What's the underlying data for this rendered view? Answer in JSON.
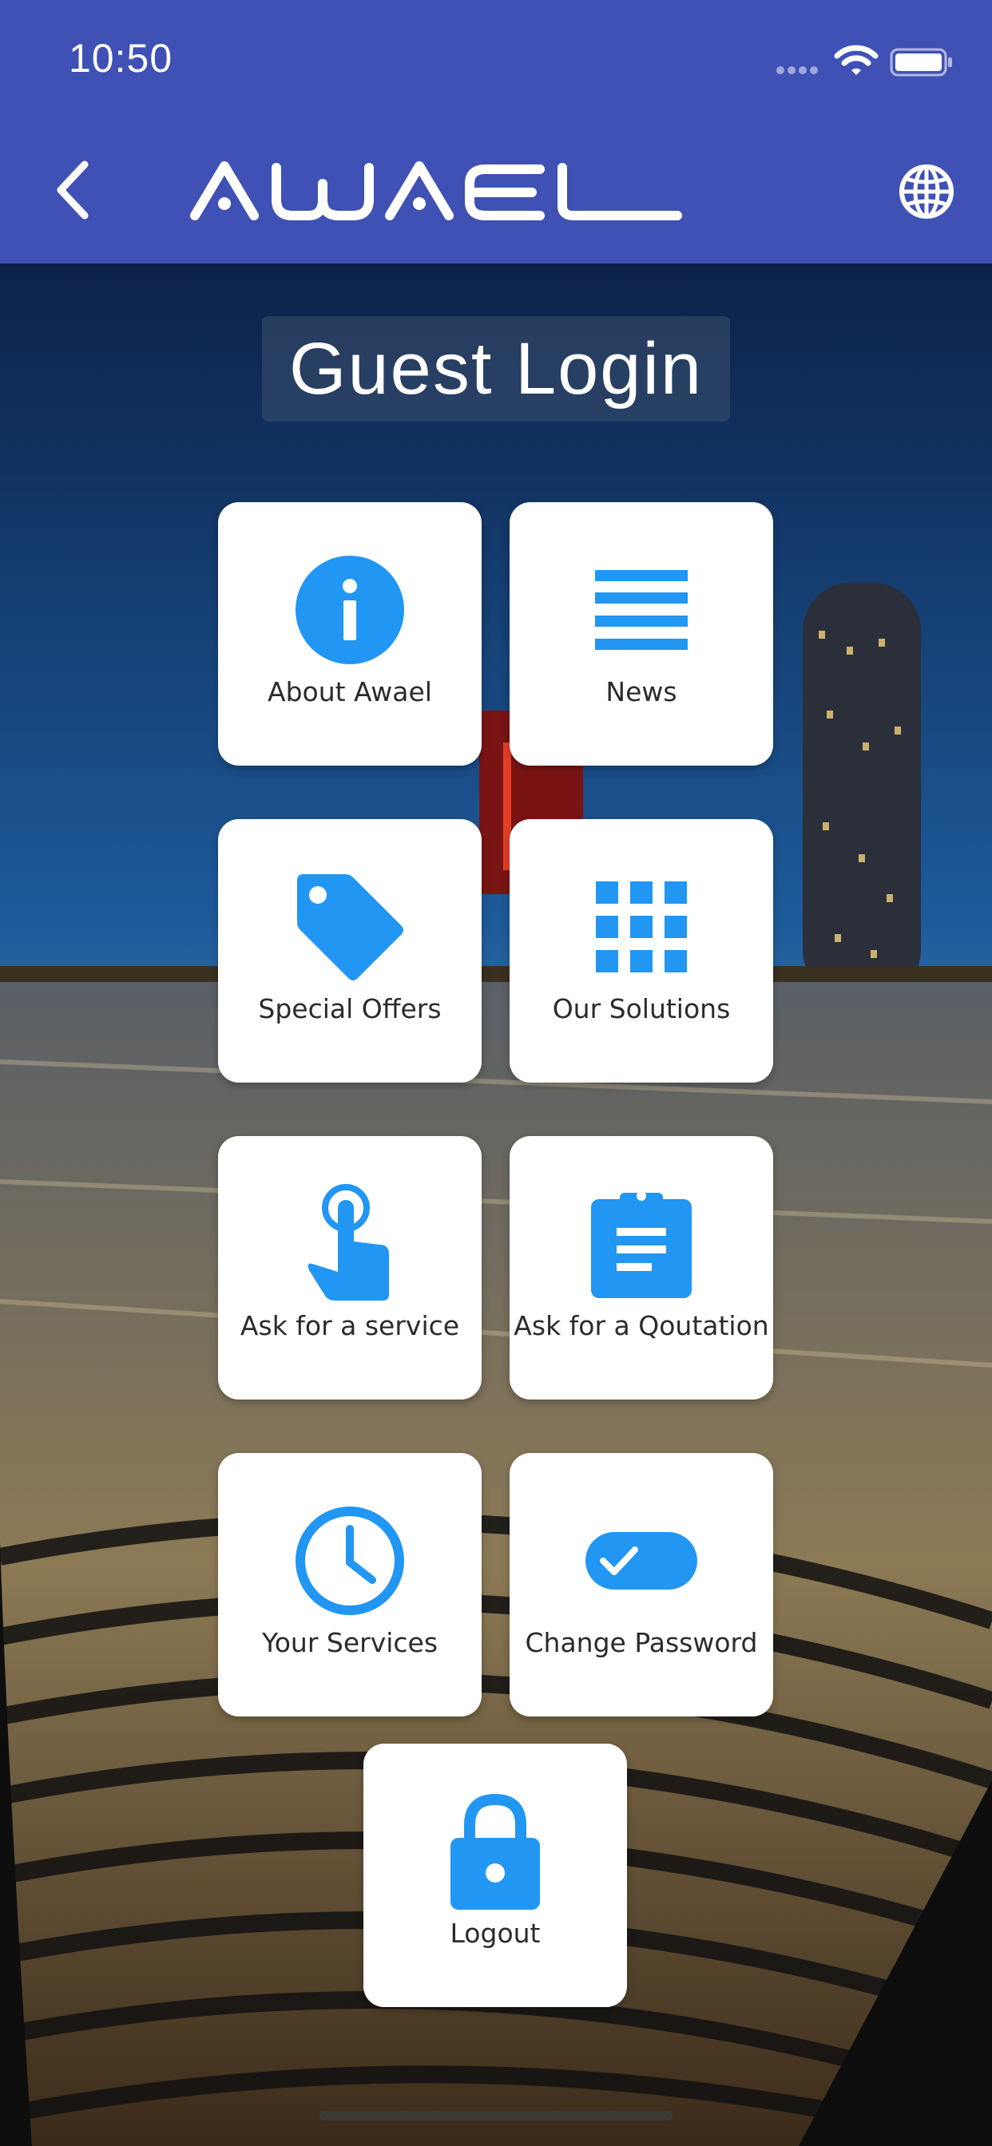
{
  "status_bar": {
    "time": "10:50"
  },
  "header": {
    "logo_text": "AWAEL"
  },
  "page": {
    "title": "Guest Login"
  },
  "tiles": [
    {
      "label": "About Awael",
      "icon": "info-icon"
    },
    {
      "label": "News",
      "icon": "list-icon"
    },
    {
      "label": "Special Offers",
      "icon": "tag-icon"
    },
    {
      "label": "Our Solutions",
      "icon": "grid-icon"
    },
    {
      "label": "Ask for a service",
      "icon": "hand-pointer-icon"
    },
    {
      "label": "Ask for a Qoutation",
      "icon": "clipboard-icon"
    },
    {
      "label": "Your Services",
      "icon": "clock-icon"
    },
    {
      "label": "Change Password",
      "icon": "toggle-check-icon"
    },
    {
      "label": "Logout",
      "icon": "lock-icon"
    }
  ],
  "colors": {
    "header_bg": "#3f51b5",
    "icon_blue": "#2196f3",
    "tile_bg": "#ffffff",
    "label_text": "#2b2b2b"
  }
}
